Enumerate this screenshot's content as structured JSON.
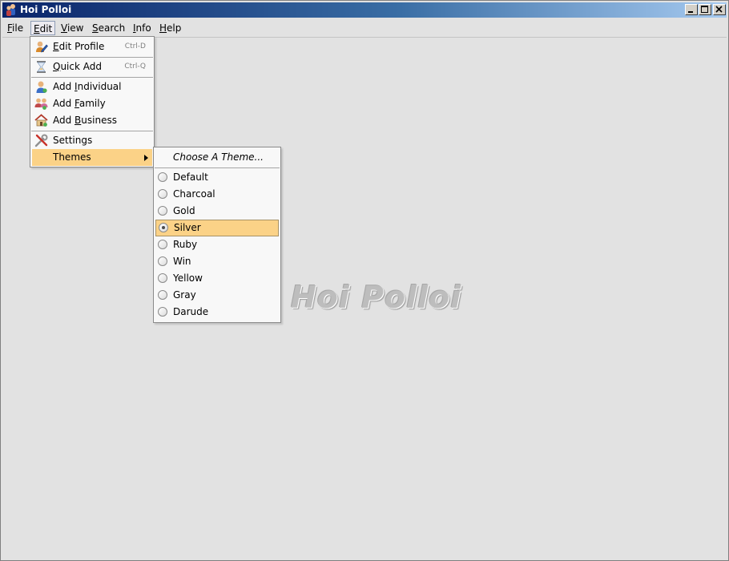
{
  "window": {
    "title": "Hoi Polloi",
    "app_icon": "people-icon",
    "controls": [
      "minimize-icon",
      "maximize-icon",
      "close-icon"
    ]
  },
  "menubar": {
    "items": [
      {
        "label": "File",
        "mnemonic": "F",
        "rest": "ile"
      },
      {
        "label": "Edit",
        "mnemonic": "E",
        "rest": "dit",
        "active": true
      },
      {
        "label": "View",
        "mnemonic": "V",
        "rest": "iew"
      },
      {
        "label": "Search",
        "mnemonic": "S",
        "rest": "earch"
      },
      {
        "label": "Info",
        "mnemonic": "I",
        "rest": "nfo"
      },
      {
        "label": "Help",
        "mnemonic": "H",
        "rest": "elp"
      }
    ]
  },
  "edit_menu": {
    "edit_profile": {
      "pre": "",
      "mn": "E",
      "post": "dit Profile",
      "shortcut": "Ctrl-D",
      "icon": "edit-profile-icon"
    },
    "quick_add": {
      "pre": "",
      "mn": "Q",
      "post": "uick Add",
      "shortcut": "Ctrl-Q",
      "icon": "hourglass-icon"
    },
    "add_individual": {
      "pre": "Add ",
      "mn": "I",
      "post": "ndividual",
      "icon": "person-icon"
    },
    "add_family": {
      "pre": "Add ",
      "mn": "F",
      "post": "amily",
      "icon": "family-icon"
    },
    "add_business": {
      "pre": "Add ",
      "mn": "B",
      "post": "usiness",
      "icon": "house-icon"
    },
    "settings": {
      "label": "Settings",
      "icon": "tools-icon"
    },
    "themes": {
      "label": "Themes",
      "highlighted": true
    }
  },
  "themes_menu": {
    "header": "Choose A Theme...",
    "selected": "Silver",
    "options": [
      "Default",
      "Charcoal",
      "Gold",
      "Silver",
      "Ruby",
      "Win",
      "Yellow",
      "Gray",
      "Darude"
    ]
  },
  "watermark": "Hoi Polloi",
  "colors": {
    "highlight": "#fbd287",
    "menu_bg": "#f8f8f8",
    "desktop_bg": "#e2e2e2"
  }
}
